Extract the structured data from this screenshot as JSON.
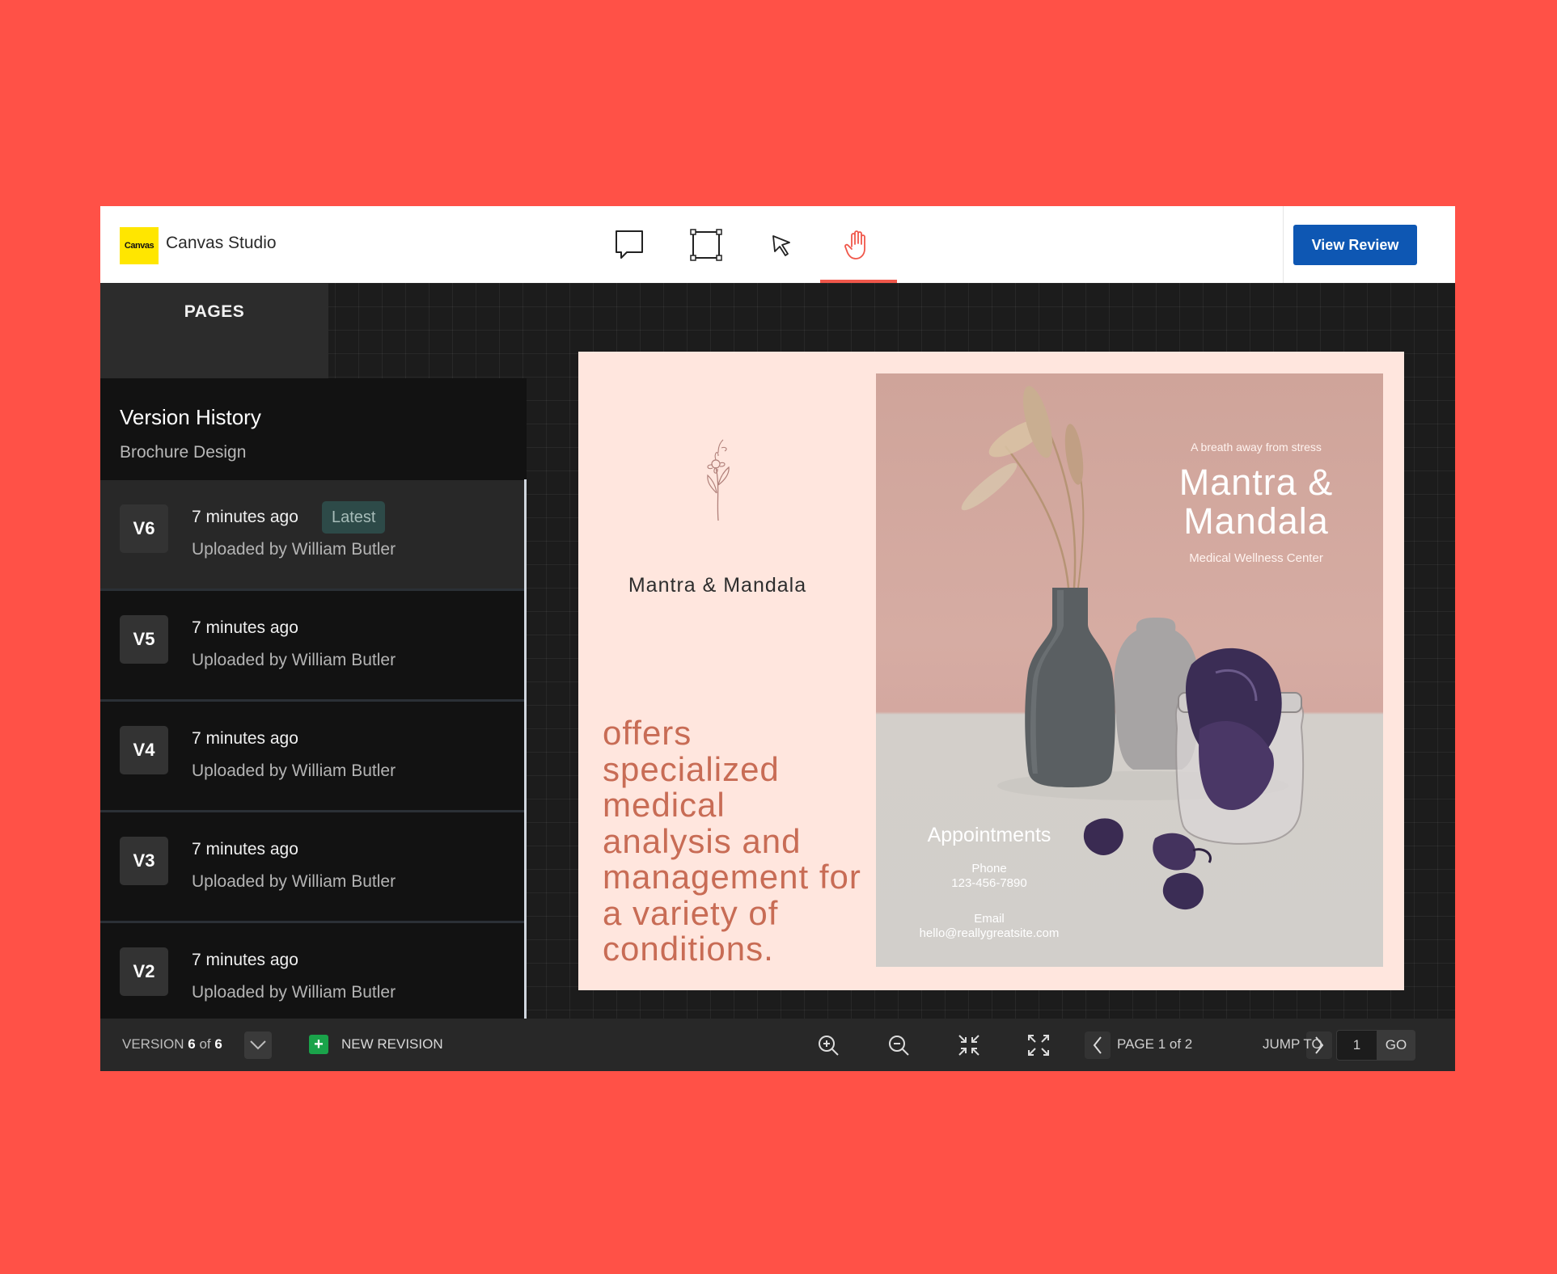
{
  "app": {
    "logo_text": "Canvas",
    "title": "Canvas Studio"
  },
  "toolbar": {
    "tools": [
      "comment-icon",
      "frame-icon",
      "pointer-icon",
      "hand-icon"
    ],
    "active_tool": "hand-icon",
    "view_review_label": "View Review"
  },
  "pages": {
    "label": "PAGES"
  },
  "version_history": {
    "title": "Version History",
    "subtitle": "Brochure Design",
    "items": [
      {
        "version": "V6",
        "time": "7 minutes ago",
        "uploader": "Uploaded by William Butler",
        "badge": "Latest"
      },
      {
        "version": "V5",
        "time": "7 minutes ago",
        "uploader": "Uploaded by William Butler"
      },
      {
        "version": "V4",
        "time": "7 minutes ago",
        "uploader": "Uploaded by William Butler"
      },
      {
        "version": "V3",
        "time": "7 minutes ago",
        "uploader": "Uploaded by William Butler"
      },
      {
        "version": "V2",
        "time": "7 minutes ago",
        "uploader": "Uploaded by William Butler"
      }
    ]
  },
  "brochure": {
    "left_brand": "Mantra & Mandala",
    "tagline": "offers specialized medical analysis and management for a variety of conditions.",
    "photo_kicker": "A breath away from stress",
    "photo_brand": "Mantra & Mandala",
    "photo_sub": "Medical Wellness Center",
    "appointments": "Appointments",
    "phone_label": "Phone",
    "phone": "123-456-7890",
    "email_label": "Email",
    "email": "hello@reallygreatsite.com"
  },
  "bottombar": {
    "version_prefix": "VERSION",
    "version_current": "6",
    "version_of": "of",
    "version_total": "6",
    "new_revision": "NEW REVISION",
    "page_indicator": "PAGE 1 of 2",
    "jump_label": "JUMP TO",
    "jump_value": "1",
    "go_label": "GO"
  },
  "colors": {
    "background": "#ff5147",
    "primary_button": "#0e57b3",
    "active_tool": "#f0574a",
    "logo": "#ffe600",
    "tagline": "#c86c55"
  }
}
